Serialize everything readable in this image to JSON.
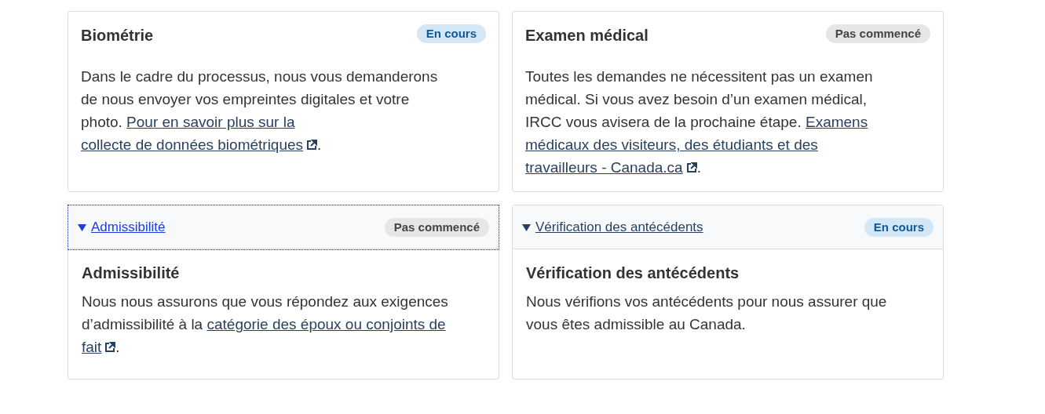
{
  "cards": [
    {
      "kind": "plain",
      "title": "Biométrie",
      "status": {
        "label": "En cours",
        "kind": "in_progress"
      },
      "body": [
        {
          "kind": "text",
          "text": "Dans le cadre du processus, nous vous demanderons de nous envoyer vos empreintes digitales et votre photo. "
        },
        {
          "kind": "link",
          "lines": [
            "Pour en savoir plus sur la",
            "collecte de données biométriques"
          ],
          "external": true
        },
        {
          "kind": "text",
          "text": "."
        }
      ]
    },
    {
      "kind": "plain",
      "title": "Examen médical",
      "status": {
        "label": "Pas commencé",
        "kind": "not_started"
      },
      "body": [
        {
          "kind": "text",
          "text": "Toutes les demandes ne nécessitent pas un examen médical. Si vous avez besoin d’un examen médical, IRCC vous avisera de la prochaine étape. "
        },
        {
          "kind": "link",
          "lines": [
            "Examens",
            "médicaux des visiteurs, des étudiants et des",
            "travailleurs - Canada.ca"
          ],
          "external": true
        },
        {
          "kind": "text",
          "text": "."
        }
      ]
    },
    {
      "kind": "details",
      "summary": "Admissibilité",
      "expanded": true,
      "focused": true,
      "title": "Admissibilité",
      "status": {
        "label": "Pas commencé",
        "kind": "not_started"
      },
      "body": [
        {
          "kind": "text",
          "text": "Nous nous assurons que vous répondez aux exigences d’admissibilité à la "
        },
        {
          "kind": "link",
          "lines": [
            "catégorie des époux ou conjoints de",
            "fait"
          ],
          "external": true
        },
        {
          "kind": "text",
          "text": "."
        }
      ]
    },
    {
      "kind": "details",
      "summary": "Vérification des antécédents",
      "expanded": true,
      "focused": false,
      "title": "Vérification des antécédents",
      "status": {
        "label": "En cours",
        "kind": "in_progress"
      },
      "body": [
        {
          "kind": "text",
          "text": "Nous vérifions vos antécédents pour nous assurer que vous êtes admissible au Canada."
        }
      ]
    }
  ]
}
